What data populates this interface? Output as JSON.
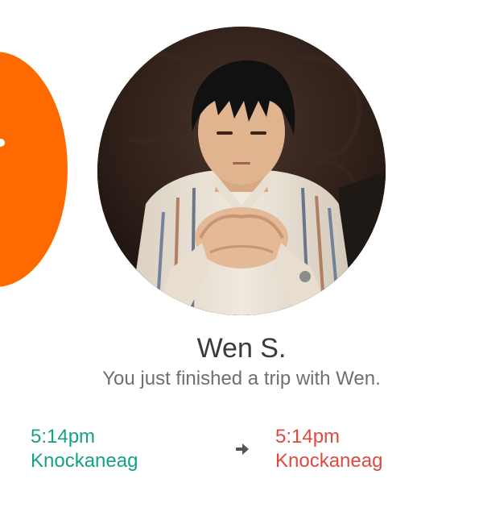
{
  "profile": {
    "name": "Wen S.",
    "subtitle": "You just finished a trip with Wen."
  },
  "trip": {
    "start": {
      "time": "5:14pm",
      "place": "Knockaneag",
      "color": "#16a085"
    },
    "end": {
      "time": "5:14pm",
      "place": "Knockaneag",
      "color": "#de4a3e"
    },
    "arrow_icon": "arrow-right-icon"
  },
  "accent_colors": {
    "orange": "#ff6a00"
  }
}
